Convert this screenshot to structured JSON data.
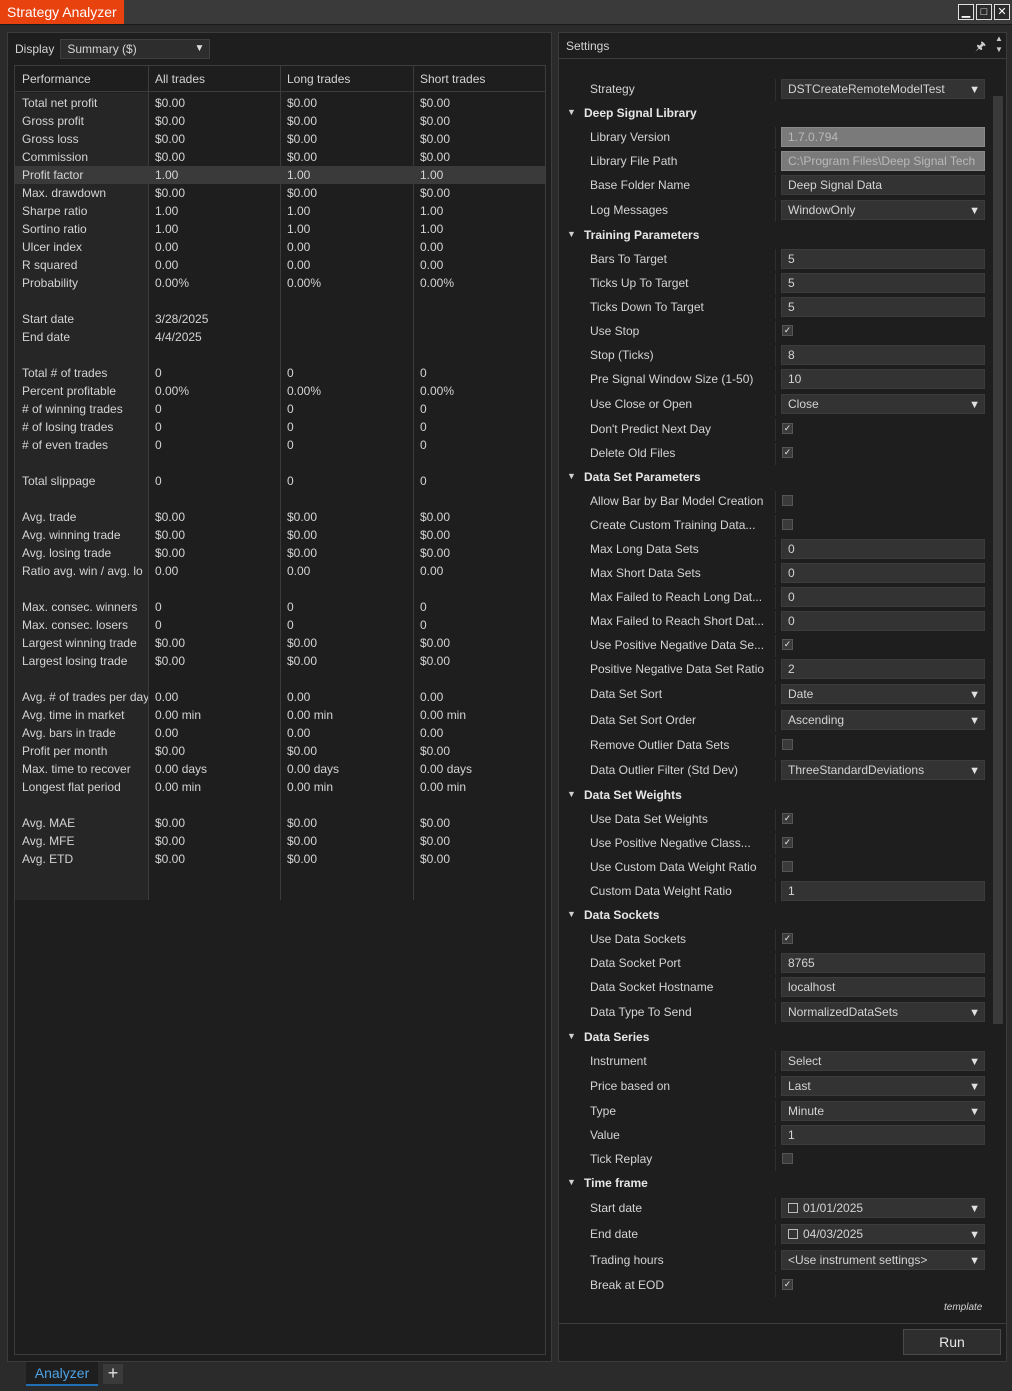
{
  "window": {
    "title": "Strategy Analyzer",
    "minimize": "▁",
    "maximize": "□",
    "close": "✕"
  },
  "display": {
    "label": "Display",
    "value": "Summary ($)"
  },
  "performance": {
    "headers": [
      "Performance",
      "All trades",
      "Long trades",
      "Short trades"
    ],
    "rows": [
      [
        "Total net profit",
        "$0.00",
        "$0.00",
        "$0.00"
      ],
      [
        "Gross profit",
        "$0.00",
        "$0.00",
        "$0.00"
      ],
      [
        "Gross loss",
        "$0.00",
        "$0.00",
        "$0.00"
      ],
      [
        "Commission",
        "$0.00",
        "$0.00",
        "$0.00"
      ],
      [
        "Profit factor",
        "1.00",
        "1.00",
        "1.00"
      ],
      [
        "Max. drawdown",
        "$0.00",
        "$0.00",
        "$0.00"
      ],
      [
        "Sharpe ratio",
        "1.00",
        "1.00",
        "1.00"
      ],
      [
        "Sortino ratio",
        "1.00",
        "1.00",
        "1.00"
      ],
      [
        "Ulcer index",
        "0.00",
        "0.00",
        "0.00"
      ],
      [
        "R squared",
        "0.00",
        "0.00",
        "0.00"
      ],
      [
        "Probability",
        "0.00%",
        "0.00%",
        "0.00%"
      ],
      [
        "",
        "",
        "",
        ""
      ],
      [
        "Start date",
        "3/28/2025",
        "",
        ""
      ],
      [
        "End date",
        "4/4/2025",
        "",
        ""
      ],
      [
        "",
        "",
        "",
        ""
      ],
      [
        "Total # of trades",
        "0",
        "0",
        "0"
      ],
      [
        "Percent profitable",
        "0.00%",
        "0.00%",
        "0.00%"
      ],
      [
        "# of winning trades",
        "0",
        "0",
        "0"
      ],
      [
        "# of losing trades",
        "0",
        "0",
        "0"
      ],
      [
        "# of even trades",
        "0",
        "0",
        "0"
      ],
      [
        "",
        "",
        "",
        ""
      ],
      [
        "Total slippage",
        "0",
        "0",
        "0"
      ],
      [
        "",
        "",
        "",
        ""
      ],
      [
        "Avg. trade",
        "$0.00",
        "$0.00",
        "$0.00"
      ],
      [
        "Avg. winning trade",
        "$0.00",
        "$0.00",
        "$0.00"
      ],
      [
        "Avg. losing trade",
        "$0.00",
        "$0.00",
        "$0.00"
      ],
      [
        "Ratio avg. win / avg. lo",
        "0.00",
        "0.00",
        "0.00"
      ],
      [
        "",
        "",
        "",
        ""
      ],
      [
        "Max. consec. winners",
        "0",
        "0",
        "0"
      ],
      [
        "Max. consec. losers",
        "0",
        "0",
        "0"
      ],
      [
        "Largest winning trade",
        "$0.00",
        "$0.00",
        "$0.00"
      ],
      [
        "Largest losing trade",
        "$0.00",
        "$0.00",
        "$0.00"
      ],
      [
        "",
        "",
        "",
        ""
      ],
      [
        "Avg. # of trades per day",
        "0.00",
        "0.00",
        "0.00"
      ],
      [
        "Avg. time in market",
        "0.00 min",
        "0.00 min",
        "0.00 min"
      ],
      [
        "Avg. bars in trade",
        "0.00",
        "0.00",
        "0.00"
      ],
      [
        "Profit per month",
        "$0.00",
        "$0.00",
        "$0.00"
      ],
      [
        "Max. time to recover",
        "0.00 days",
        "0.00 days",
        "0.00 days"
      ],
      [
        "Longest flat period",
        "0.00 min",
        "0.00 min",
        "0.00 min"
      ],
      [
        "",
        "",
        "",
        ""
      ],
      [
        "Avg. MAE",
        "$0.00",
        "$0.00",
        "$0.00"
      ],
      [
        "Avg. MFE",
        "$0.00",
        "$0.00",
        "$0.00"
      ],
      [
        "Avg. ETD",
        "$0.00",
        "$0.00",
        "$0.00"
      ]
    ],
    "highlight_row": 4
  },
  "settings": {
    "title": "Settings",
    "template_label": "template",
    "run_label": "Run",
    "rows": [
      {
        "kind": "prop",
        "label": "Strategy",
        "type": "dropdown",
        "value": "DSTCreateRemoteModelTest"
      },
      {
        "kind": "cat",
        "label": "Deep Signal Library"
      },
      {
        "kind": "prop",
        "label": "Library Version",
        "type": "disabled",
        "value": "1.7.0.794"
      },
      {
        "kind": "prop",
        "label": "Library File Path",
        "type": "disabled",
        "value": "C:\\Program Files\\Deep Signal Tech"
      },
      {
        "kind": "prop",
        "label": "Base Folder Name",
        "type": "text",
        "value": "Deep Signal Data"
      },
      {
        "kind": "prop",
        "label": "Log Messages",
        "type": "dropdown",
        "value": "WindowOnly"
      },
      {
        "kind": "cat",
        "label": "Training Parameters"
      },
      {
        "kind": "prop",
        "label": "Bars To Target",
        "type": "text",
        "value": "5"
      },
      {
        "kind": "prop",
        "label": "Ticks Up To Target",
        "type": "text",
        "value": "5"
      },
      {
        "kind": "prop",
        "label": "Ticks Down To Target",
        "type": "text",
        "value": "5"
      },
      {
        "kind": "prop",
        "label": "Use Stop",
        "type": "check",
        "checked": true
      },
      {
        "kind": "prop",
        "label": "Stop (Ticks)",
        "type": "text",
        "value": "8"
      },
      {
        "kind": "prop",
        "label": "Pre Signal Window Size (1-50)",
        "type": "text",
        "value": "10"
      },
      {
        "kind": "prop",
        "label": "Use Close or Open",
        "type": "dropdown",
        "value": "Close"
      },
      {
        "kind": "prop",
        "label": "Don't Predict Next Day",
        "type": "check",
        "checked": true
      },
      {
        "kind": "prop",
        "label": "Delete Old Files",
        "type": "check",
        "checked": true
      },
      {
        "kind": "cat",
        "label": "Data Set Parameters"
      },
      {
        "kind": "prop",
        "label": "Allow Bar by Bar Model Creation",
        "type": "check",
        "checked": false
      },
      {
        "kind": "prop",
        "label": "Create Custom Training Data...",
        "type": "check",
        "checked": false
      },
      {
        "kind": "prop",
        "label": "Max Long Data Sets",
        "type": "text",
        "value": "0"
      },
      {
        "kind": "prop",
        "label": "Max Short Data Sets",
        "type": "text",
        "value": "0"
      },
      {
        "kind": "prop",
        "label": "Max Failed to Reach Long Dat...",
        "type": "text",
        "value": "0"
      },
      {
        "kind": "prop",
        "label": "Max Failed to Reach Short Dat...",
        "type": "text",
        "value": "0"
      },
      {
        "kind": "prop",
        "label": "Use Positive Negative Data Se...",
        "type": "check",
        "checked": true
      },
      {
        "kind": "prop",
        "label": "Positive Negative Data Set Ratio",
        "type": "text",
        "value": "2"
      },
      {
        "kind": "prop",
        "label": "Data Set Sort",
        "type": "dropdown",
        "value": "Date"
      },
      {
        "kind": "prop",
        "label": "Data Set Sort Order",
        "type": "dropdown",
        "value": "Ascending"
      },
      {
        "kind": "prop",
        "label": "Remove Outlier Data Sets",
        "type": "check",
        "checked": false
      },
      {
        "kind": "prop",
        "label": "Data Outlier Filter (Std Dev)",
        "type": "dropdown",
        "value": "ThreeStandardDeviations"
      },
      {
        "kind": "cat",
        "label": "Data Set Weights"
      },
      {
        "kind": "prop",
        "label": "Use Data Set Weights",
        "type": "check",
        "checked": true
      },
      {
        "kind": "prop",
        "label": "Use Positive Negative Class...",
        "type": "check",
        "checked": true
      },
      {
        "kind": "prop",
        "label": "Use Custom Data Weight Ratio",
        "type": "check",
        "checked": false
      },
      {
        "kind": "prop",
        "label": "Custom Data Weight Ratio",
        "type": "text",
        "value": "1"
      },
      {
        "kind": "cat",
        "label": "Data Sockets"
      },
      {
        "kind": "prop",
        "label": "Use Data Sockets",
        "type": "check",
        "checked": true
      },
      {
        "kind": "prop",
        "label": "Data Socket Port",
        "type": "text",
        "value": "8765"
      },
      {
        "kind": "prop",
        "label": "Data Socket Hostname",
        "type": "text",
        "value": "localhost"
      },
      {
        "kind": "prop",
        "label": "Data Type To Send",
        "type": "dropdown",
        "value": "NormalizedDataSets"
      },
      {
        "kind": "cat",
        "label": "Data Series"
      },
      {
        "kind": "prop",
        "label": "Instrument",
        "type": "dropdown",
        "value": "Select"
      },
      {
        "kind": "prop",
        "label": "Price based on",
        "type": "dropdown",
        "value": "Last"
      },
      {
        "kind": "prop",
        "label": "Type",
        "type": "dropdown",
        "value": "Minute"
      },
      {
        "kind": "prop",
        "label": "Value",
        "type": "text",
        "value": "1"
      },
      {
        "kind": "prop",
        "label": "Tick Replay",
        "type": "check",
        "checked": false
      },
      {
        "kind": "cat",
        "label": "Time frame"
      },
      {
        "kind": "prop",
        "label": "Start date",
        "type": "date",
        "value": "01/01/2025"
      },
      {
        "kind": "prop",
        "label": "End date",
        "type": "date",
        "value": "04/03/2025"
      },
      {
        "kind": "prop",
        "label": "Trading hours",
        "type": "dropdown",
        "value": "<Use instrument settings>"
      },
      {
        "kind": "prop",
        "label": "Break at EOD",
        "type": "check",
        "checked": true
      }
    ]
  },
  "bottom_tabs": {
    "active": "Analyzer",
    "add": "+"
  },
  "colors": {
    "accent": "#e8420f",
    "tab_active": "#4da3e6",
    "background": "#1e1e1e"
  }
}
